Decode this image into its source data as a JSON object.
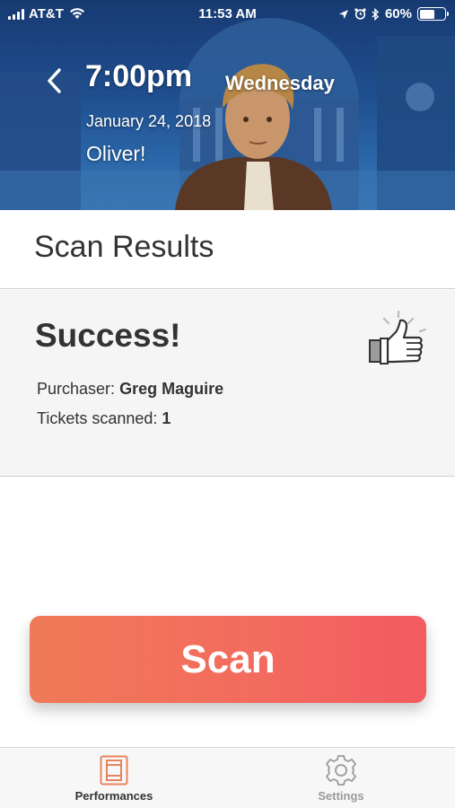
{
  "status_bar": {
    "carrier": "AT&T",
    "time": "11:53 AM",
    "battery_percent": "60%",
    "battery_level": 0.6
  },
  "header": {
    "time": "7:00pm",
    "day": "Wednesday",
    "date": "January 24, 2018",
    "show": "Oliver!"
  },
  "scan_results": {
    "title": "Scan Results",
    "status": "Success!",
    "purchaser_label": "Purchaser:",
    "purchaser_name": "Greg Maguire",
    "tickets_label": "Tickets scanned:",
    "tickets_count": "1",
    "status_icon": "thumbs-up-icon"
  },
  "scan_button": {
    "label": "Scan"
  },
  "tab_bar": {
    "items": [
      {
        "label": "Performances",
        "icon": "ticket-icon",
        "active": true
      },
      {
        "label": "Settings",
        "icon": "gear-icon",
        "active": false
      }
    ]
  },
  "colors": {
    "scan_gradient_start": "#f07a57",
    "scan_gradient_end": "#f25b61",
    "active_tab_icon": "#e8835f",
    "inactive_tab": "#9a9a9a"
  }
}
